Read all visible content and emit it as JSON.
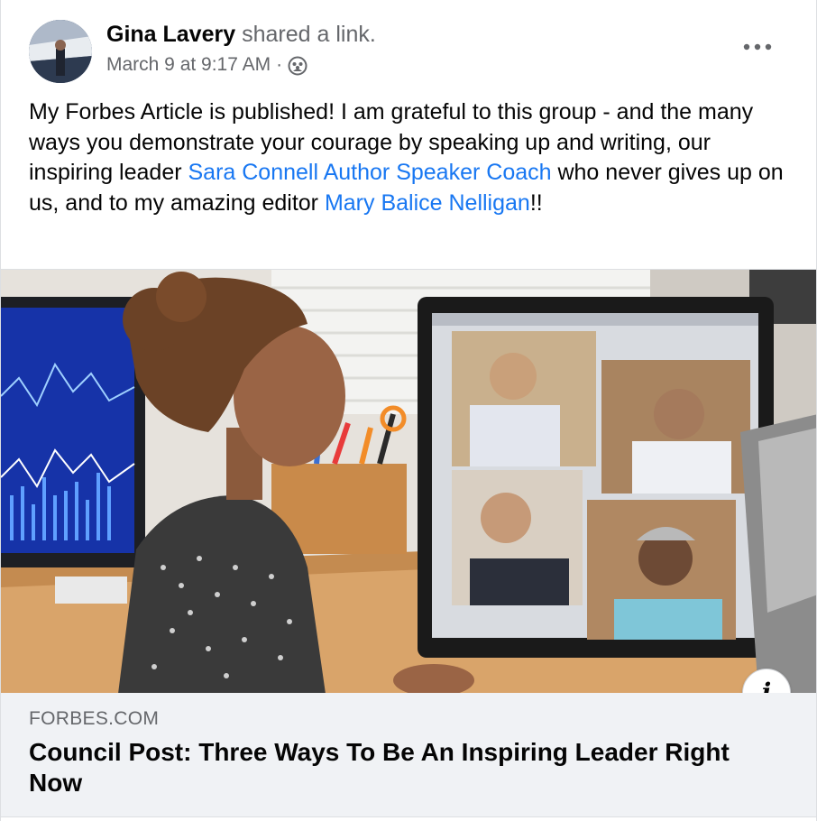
{
  "post": {
    "author": "Gina Lavery",
    "action": "shared a link.",
    "timestamp": "March 9 at 9:17 AM",
    "separator": "·",
    "audience_icon": "group-icon",
    "more_icon": "more-options-icon",
    "text": {
      "part1": "My Forbes Article is published!  I  am grateful to this group - and the many ways you demonstrate your courage by speaking up and writing, our inspiring leader ",
      "mention1": "Sara Connell Author Speaker Coach",
      "part2": " who never gives up on us, and to my amazing editor ",
      "mention2": "Mary Balice Nelligan",
      "part3": "!!"
    }
  },
  "link_preview": {
    "info_icon": "info-icon",
    "info_glyph": "i",
    "domain": "FORBES.COM",
    "title": "Council Post: Three Ways To Be An Inspiring Leader Right Now"
  },
  "colors": {
    "link": "#1877f2",
    "text": "#050505",
    "secondary": "#65676b",
    "footer_bg": "#f0f2f5"
  }
}
